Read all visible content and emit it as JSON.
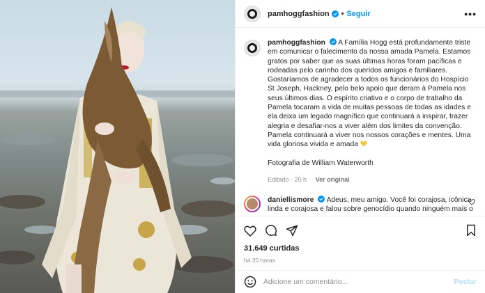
{
  "header": {
    "username": "pamhoggfashion",
    "separator": "•",
    "follow_label": "Seguir",
    "more_label": "•••"
  },
  "caption": {
    "username": "pamhoggfashion",
    "text": "A Família Hogg está profundamente triste em comunicar o falecimento da nossa amada Pamela. Estamos gratos por saber que as suas últimas horas foram pacíficas e rodeadas pelo carinho dos queridos amigos e familiares. Gostaríamos de agradecer a todos os funcionários do Hospício St Joseph, Hackney, pelo belo apoio que deram à Pamela nos seus últimos dias. O espírito criativo e o corpo de trabalho da Pamela tocaram a vida de muitas pessoas de todas as idades e ela deixa um legado magnífico que continuará a inspirar, trazer alegria e desafiar-nos a viver além dos limites da convenção. Pamela continuará a viver nos nossos corações e mentes. Uma vida gloriosa vivida e amada",
    "credit": "Fotografia de William Waterworth",
    "edited": "Editado · 20 h",
    "translate": "Ver original"
  },
  "comment": {
    "username": "daniellismore",
    "text": "Adeus, meu amigo. Você foi corajosa, icônica linda e corajosa e falou sobre genocídio quando ninguém mais o faria. Vamos sentir saudades tuas e dos teus shows. Amo-te x"
  },
  "stats": {
    "likes": "31.649 curtidas",
    "time": "há 20 horas"
  },
  "composer": {
    "placeholder": "Adicione um comentário...",
    "post_label": "Postar"
  },
  "colors": {
    "accent": "#0095f6",
    "muted": "#8e8e8e",
    "verified": "#0095f6"
  },
  "icons": [
    "verified-badge-icon",
    "more-options-icon",
    "heart-icon",
    "comment-icon",
    "share-icon",
    "bookmark-icon",
    "emoji-icon",
    "yellow-heart-emoji"
  ]
}
